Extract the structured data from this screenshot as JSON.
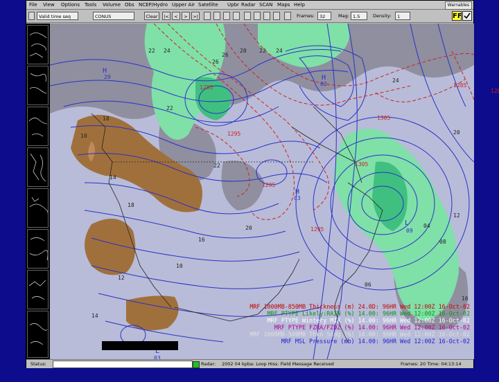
{
  "menu": [
    "File",
    "View",
    "Options",
    "Tools",
    "Volume",
    "Obs",
    "NCEP/Hydro",
    "Upper Air",
    "Satellite",
    "Upbr",
    "Radar",
    "SCAN",
    "Maps",
    "Help"
  ],
  "menu_right_button": "Warnables",
  "toolbar": {
    "time_mode": "Valid time seq",
    "scale": "CONUS",
    "clear_label": "Clear",
    "nav_buttons": [
      "|<",
      "<",
      ">",
      ">|"
    ],
    "frames_label": "Frames:",
    "frames_value": "32",
    "mag_label": "Mag:",
    "mag_value": "1.5",
    "density_label": "Density:",
    "density_value": "1",
    "ff_label": "FF"
  },
  "map_text": {
    "top_labels": [
      "22",
      "24",
      "26",
      "20",
      "22",
      "24"
    ],
    "pressure_labels": [
      "H",
      "H",
      "H",
      "L",
      "L",
      "H"
    ],
    "pressure_values": [
      "29",
      "02",
      "03",
      "09",
      "C3"
    ],
    "thickness_labels": [
      "1285",
      "1295",
      "1305",
      "1305",
      "1295",
      "1285",
      "1285",
      "1295"
    ],
    "isobar_labels": [
      "10",
      "14",
      "18",
      "22",
      "26",
      "16",
      "20",
      "04",
      "08",
      "12",
      "06",
      "10",
      "14",
      "18",
      "22",
      "24",
      "20",
      "16",
      "12"
    ]
  },
  "legend": [
    {
      "text": "MRF 1000MB-850MB Thickness (m) 24.0D: 96HR Wed 12:00Z 16-Oct-02",
      "color": "#c80000"
    },
    {
      "text": "MRF PTYPE Likely:RAIN (%) 14.00: 96HR Wed 12:00Z 16-Oct-02",
      "color": "#109010"
    },
    {
      "text": "MRF PTYPE Wintery MIX (%) 14.00: 96HR Wed 12:00Z 16-Oct-02",
      "color": "#ffffff"
    },
    {
      "text": "MRF PTYPE FZRA/FZDZ (%) 14.00: 96HR Wed 12:00Z 16-Oct-02",
      "color": "#b00090"
    },
    {
      "text": "MRF 1000MB-500MB Thkn Sndg (%) 14.00: 96HR Wed 12:00Z 16-Oct-02",
      "color": "#e0e0e0"
    },
    {
      "text": "MRF MSL Pressure (mb) 14.00: 96HR Wed 12:00Z 16-Oct-02",
      "color": "#2020d0"
    }
  ],
  "status": {
    "status_label": "Status:",
    "radar_label": "Radar:",
    "message": "2002 04 kpba: Loop Hiss: Field Message Received",
    "frames_info": "Frames: 20  Time: 04:13:14"
  },
  "colors": {
    "map_background": "#b8bcd8",
    "rain_fill": "#7fe0a8",
    "rain_dark": "#40c080",
    "snow_fill": "#8f8f9f",
    "mix_fill": "#a0703c",
    "isobar": "#2a30c8",
    "thickness": "#d02020"
  }
}
